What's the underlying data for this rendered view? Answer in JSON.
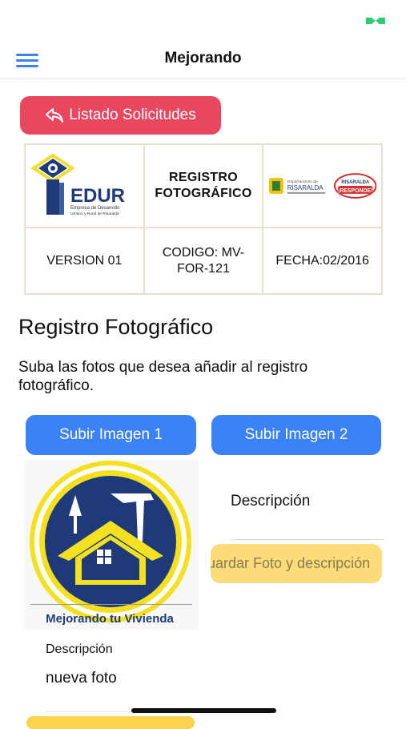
{
  "header": {
    "title": "Mejorando",
    "menu_icon": "hamburger-menu-icon"
  },
  "back_button": {
    "label": "Listado Solicitudes",
    "icon": "reply-arrow-icon"
  },
  "doc_table": {
    "logo_name": "EDUR",
    "logo_subtitle_1": "Empresa de Desarrollo",
    "logo_subtitle_2": "Urbano y Rural de Risaralda",
    "title": "REGISTRO FOTOGRÁFICO",
    "gov_logo_1_line_1": "Departamento de",
    "gov_logo_1_line_2": "RISARALDA",
    "gov_logo_2_line_1": "RISARALDA",
    "gov_logo_2_line_2": "¡RESPONDE!",
    "version": "VERSION 01",
    "codigo": "CODIGO: MV-FOR-121",
    "fecha": "FECHA:02/2016"
  },
  "section": {
    "title": "Registro Fotográfico",
    "description": "Suba las fotos que desea añadir al registro fotográfico."
  },
  "upload_1": {
    "label": "Subir Imagen 1"
  },
  "upload_2": {
    "label": "Subir Imagen 2"
  },
  "photo": {
    "caption": "Mejorando tu Vivienda"
  },
  "right_panel": {
    "description_label": "Descripción",
    "save_label": "Guardar Foto y descripción"
  },
  "photo_1_form": {
    "description_label": "Descripción",
    "description_value": "nueva foto"
  },
  "colors": {
    "accent_blue": "#3b82f6",
    "back_red": "#e8475f",
    "save_yellow": "#fcdc78",
    "logo_navy": "#1f3a7a",
    "logo_yellow": "#f3dc2a"
  }
}
